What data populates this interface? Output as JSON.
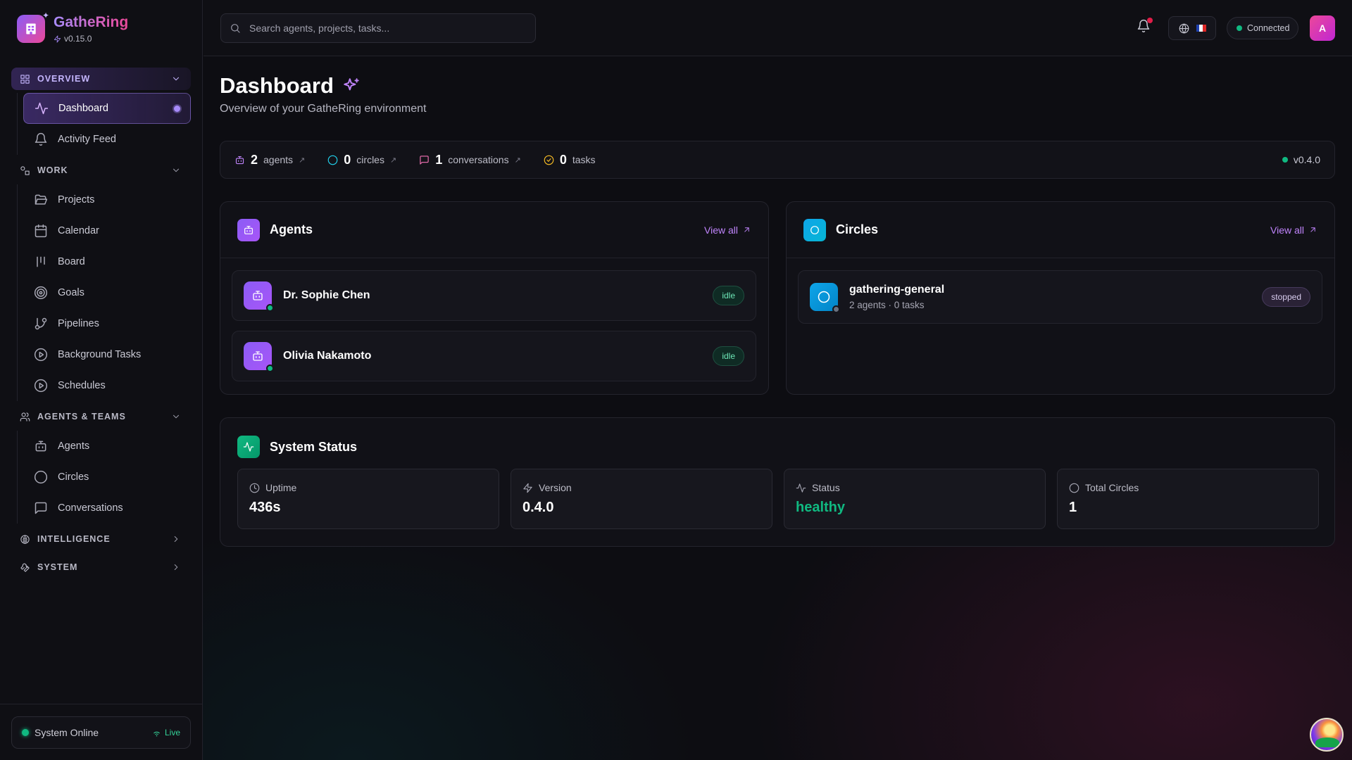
{
  "brand": {
    "name": "GatheRing",
    "version": "v0.15.0"
  },
  "sidebar": {
    "sections": [
      {
        "label": "OVERVIEW",
        "items": [
          {
            "label": "Dashboard"
          },
          {
            "label": "Activity Feed"
          }
        ]
      },
      {
        "label": "WORK",
        "items": [
          {
            "label": "Projects"
          },
          {
            "label": "Calendar"
          },
          {
            "label": "Board"
          },
          {
            "label": "Goals"
          },
          {
            "label": "Pipelines"
          },
          {
            "label": "Background Tasks"
          },
          {
            "label": "Schedules"
          }
        ]
      },
      {
        "label": "AGENTS & TEAMS",
        "items": [
          {
            "label": "Agents"
          },
          {
            "label": "Circles"
          },
          {
            "label": "Conversations"
          }
        ]
      },
      {
        "label": "INTELLIGENCE"
      },
      {
        "label": "SYSTEM"
      }
    ],
    "footer": {
      "status": "System Online",
      "live": "Live"
    }
  },
  "topbar": {
    "search_placeholder": "Search agents, projects, tasks...",
    "connection": "Connected",
    "avatar_initial": "A"
  },
  "page": {
    "title": "Dashboard",
    "subtitle": "Overview of your GatheRing environment"
  },
  "stats": {
    "agents": {
      "count": "2",
      "label": "agents"
    },
    "circles": {
      "count": "0",
      "label": "circles"
    },
    "conversations": {
      "count": "1",
      "label": "conversations"
    },
    "tasks": {
      "count": "0",
      "label": "tasks"
    },
    "version": "v0.4.0"
  },
  "agents_card": {
    "title": "Agents",
    "view_all": "View all",
    "items": [
      {
        "name": "Dr. Sophie Chen",
        "status": "idle"
      },
      {
        "name": "Olivia Nakamoto",
        "status": "idle"
      }
    ]
  },
  "circles_card": {
    "title": "Circles",
    "view_all": "View all",
    "items": [
      {
        "name": "gathering-general",
        "meta": "2 agents · 0 tasks",
        "status": "stopped"
      }
    ]
  },
  "system_status": {
    "title": "System Status",
    "metrics": [
      {
        "label": "Uptime",
        "value": "436s"
      },
      {
        "label": "Version",
        "value": "0.4.0"
      },
      {
        "label": "Status",
        "value": "healthy"
      },
      {
        "label": "Total Circles",
        "value": "1"
      }
    ]
  },
  "colors": {
    "accent": "#8b5cf6",
    "pink": "#ec4899",
    "success": "#10b981",
    "cyan": "#0ea5e9"
  }
}
